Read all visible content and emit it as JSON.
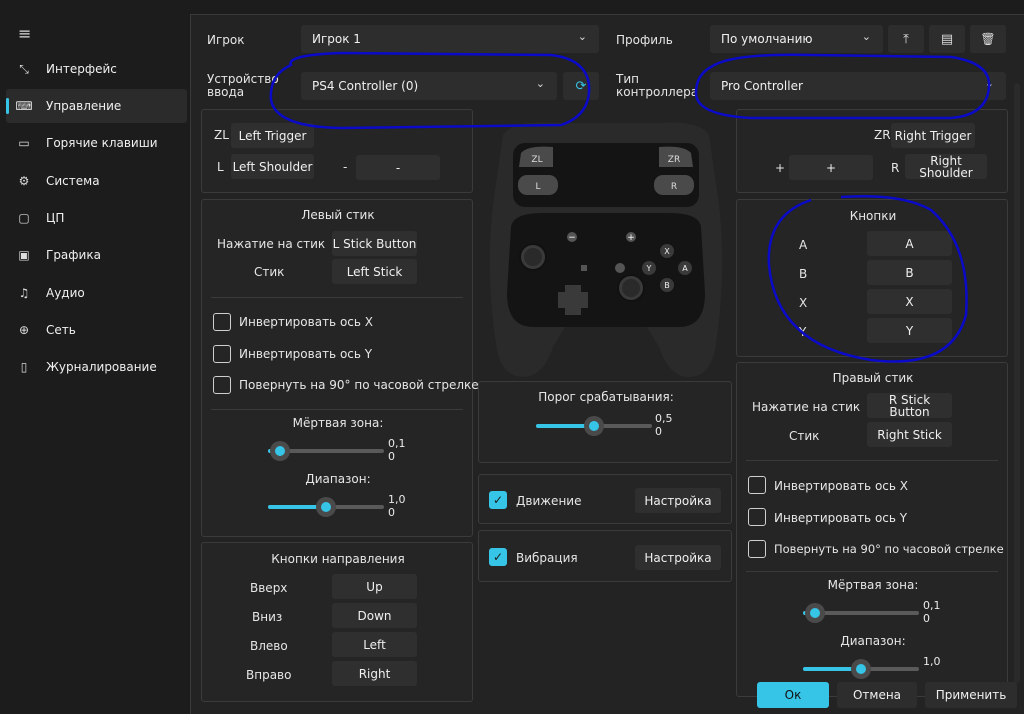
{
  "sidebar": {
    "menu_icon": "≡",
    "items": [
      {
        "label": "Интерфейс",
        "icon": "⤡"
      },
      {
        "label": "Управление",
        "icon": "⌨"
      },
      {
        "label": "Горячие клавиши",
        "icon": "▭"
      },
      {
        "label": "Система",
        "icon": "⚙"
      },
      {
        "label": "ЦП",
        "icon": "▢"
      },
      {
        "label": "Графика",
        "icon": "▣"
      },
      {
        "label": "Аудио",
        "icon": "♫"
      },
      {
        "label": "Сеть",
        "icon": "⊕"
      },
      {
        "label": "Журналирование",
        "icon": "▯"
      }
    ]
  },
  "top": {
    "player_label": "Игрок",
    "player_value": "Игрок 1",
    "profile_label": "Профиль",
    "profile_value": "По умолчанию",
    "device_label_1": "Устройство",
    "device_label_2": "ввода",
    "device_value": "PS4 Controller (0)",
    "ctype_label_1": "Тип",
    "ctype_label_2": "контроллера",
    "ctype_value": "Pro Controller",
    "upload_icon": "⤒",
    "save_icon": "▤",
    "delete_icon": "🗑",
    "refresh_icon": "⟳",
    "chevron": "⌄"
  },
  "left_triggers": {
    "zl_label": "ZL",
    "zl_value": "Left Trigger",
    "l_label": "L",
    "l_value": "Left Shoulder",
    "minus_label": "-",
    "minus_value": "-"
  },
  "right_triggers": {
    "zr_label": "ZR",
    "zr_value": "Right Trigger",
    "r_label": "R",
    "r_value": "Right Shoulder",
    "plus_label": "+",
    "plus_value": "+"
  },
  "left_stick": {
    "title": "Левый стик",
    "press_label": "Нажатие на стик",
    "press_value": "L Stick Button",
    "stick_label": "Стик",
    "stick_value": "Left Stick",
    "invert_x": "Инвертировать ось X",
    "invert_y": "Инвертировать ось Y",
    "rotate": "Повернуть на 90° по часовой стрелке",
    "deadzone_label": "Мёртвая зона:",
    "deadzone_value": "0,1",
    "deadzone_value2": "0",
    "deadzone_fraction": 0.1,
    "range_label": "Диапазон:",
    "range_value": "1,0",
    "range_value2": "0",
    "range_fraction": 0.5
  },
  "dpad": {
    "title": "Кнопки направления",
    "rows": [
      {
        "label": "Вверх",
        "value": "Up"
      },
      {
        "label": "Вниз",
        "value": "Down"
      },
      {
        "label": "Влево",
        "value": "Left"
      },
      {
        "label": "Вправо",
        "value": "Right"
      }
    ]
  },
  "controller": {
    "zl": "ZL",
    "zr": "ZR",
    "l": "L",
    "r": "R",
    "minus": "−",
    "plus": "+",
    "x": "X",
    "y": "Y",
    "a": "A",
    "b": "B"
  },
  "trigger_threshold": {
    "label": "Порог срабатывания:",
    "value": "0,5",
    "value2": "0",
    "fraction": 0.5
  },
  "motion": {
    "label": "Движение",
    "button": "Настройка",
    "checked": "✓"
  },
  "rumble": {
    "label": "Вибрация",
    "button": "Настройка",
    "checked": "✓"
  },
  "buttons": {
    "title": "Кнопки",
    "rows": [
      {
        "label": "A",
        "value": "A"
      },
      {
        "label": "B",
        "value": "B"
      },
      {
        "label": "X",
        "value": "X"
      },
      {
        "label": "Y",
        "value": "Y"
      }
    ]
  },
  "right_stick": {
    "title": "Правый стик",
    "press_label": "Нажатие на стик",
    "press_value": "R Stick Button",
    "stick_label": "Стик",
    "stick_value": "Right Stick",
    "invert_x": "Инвертировать ось X",
    "invert_y": "Инвертировать ось Y",
    "rotate": "Повернуть на 90° по часовой стрелке",
    "deadzone_label": "Мёртвая зона:",
    "deadzone_value": "0,1",
    "deadzone_value2": "0",
    "deadzone_fraction": 0.1,
    "range_label": "Диапазон:",
    "range_value": "1,0",
    "range_fraction": 0.5
  },
  "footer": {
    "ok": "Ок",
    "cancel": "Отмена",
    "apply": "Применить"
  },
  "colors": {
    "accent": "#36c5e6",
    "annotation": "#0a0ac8"
  }
}
